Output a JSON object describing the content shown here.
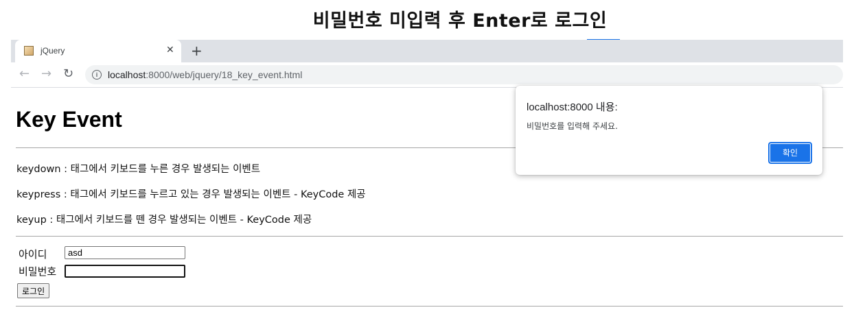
{
  "slide": {
    "title": "비밀번호 미입력 후 Enter로 로그인"
  },
  "browser": {
    "tab": {
      "title": "jQuery",
      "favicon": "jquery-favicon-icon"
    },
    "url": {
      "host": "localhost",
      "path": ":8000/web/jquery/18_key_event.html"
    }
  },
  "page": {
    "heading": "Key Event",
    "descriptions": [
      "keydown : 태그에서 키보드를 누른 경우 발생되는 이벤트",
      "keypress : 태그에서 키보드를 누르고 있는 경우 발생되는 이벤트 - KeyCode 제공",
      "keyup : 태그에서 키보드를 뗀 경우 발생되는 이벤트 - KeyCode 제공"
    ],
    "form": {
      "id_label": "아이디",
      "id_value": "asd",
      "pw_label": "비밀번호",
      "pw_value": "",
      "login_button": "로그인"
    }
  },
  "dialog": {
    "title": "localhost:8000 내용:",
    "message": "비밀번호를 입력해 주세요.",
    "ok_button": "확인"
  },
  "colors": {
    "accent": "#1a73e8",
    "tabstrip": "#dee1e6"
  }
}
